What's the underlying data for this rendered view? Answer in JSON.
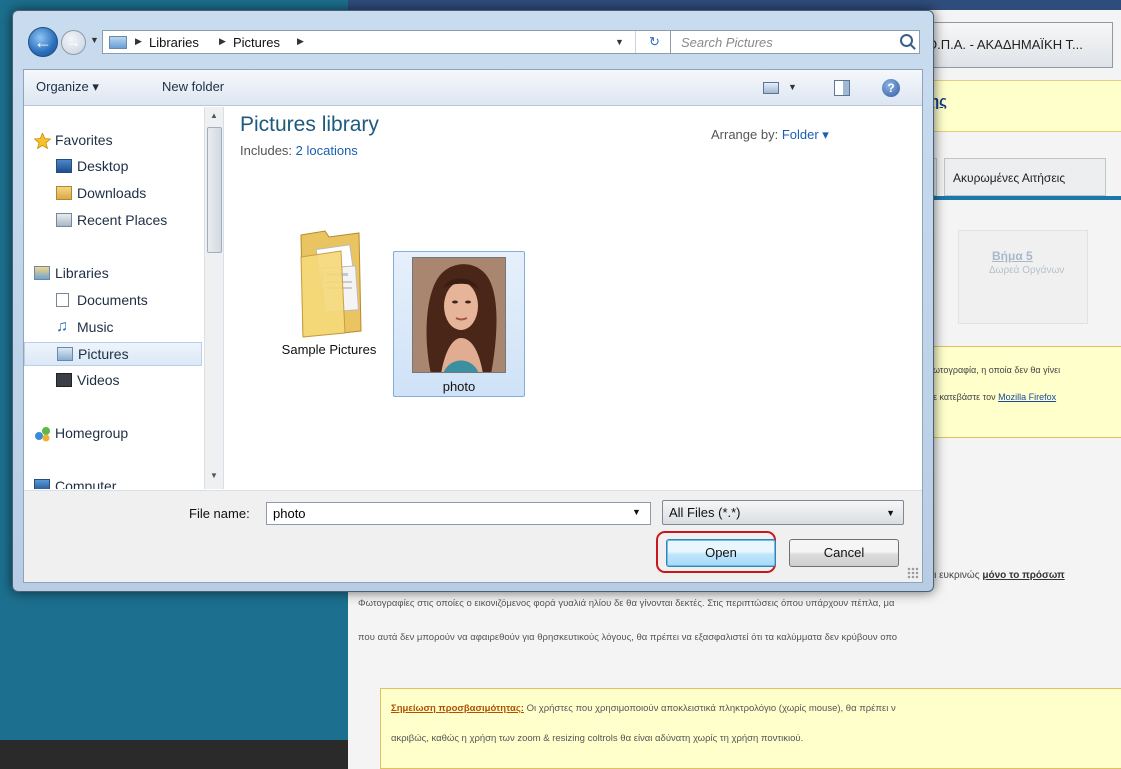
{
  "background_page": {
    "tab_title": "Ο.Π.Α. - ΑΚΑΔΗΜΑΪΚΗ Τ...",
    "header_link": "ης",
    "tabs": [
      "ς",
      "Ακυρωμένες Αιτήσεις"
    ],
    "step_title": "Βήμα 5",
    "step_subtitle": "Δωρεά Οργάνων",
    "notice_line1": "ωτογραφία, η οποία δεν θα γίνει",
    "notice_line2_prefix": "ε κατεβάστε τον ",
    "notice_link": "Mozilla Firefox",
    "partial_text_prefix": "ίζει ευκρινώς ",
    "partial_text_bold": "μόνο το πρόσωπ",
    "paragraph_line1": "Φωτογραφίες στις οποίες ο εικονιζόμενος φορά γυαλιά ηλίου δε θα γίνονται δεκτές. Στις περιπτώσεις όπου υπάρχουν πέπλα, μα",
    "paragraph_line2": "που αυτά δεν μπορούν να αφαιρεθούν για θρησκευτικούς λόγους, θα πρέπει να εξασφαλιστεί ότι τα καλύμματα δεν κρύβουν οπο",
    "accessibility_label": "Σημείωση προσβασιμότητας:",
    "accessibility_line1": " Οι χρήστες που χρησιμοποιούν αποκλειστικά πληκτρολόγιο (χωρίς mouse), θα πρέπει ν",
    "accessibility_line2": "ακριβώς, καθώς η χρήση των zoom & resizing coltrols θα είναι αδύνατη χωρίς τη χρήση ποντικιού."
  },
  "dialog": {
    "breadcrumbs": [
      "Libraries",
      "Pictures"
    ],
    "search_placeholder": "Search Pictures",
    "toolbar": {
      "organize": "Organize ▾",
      "new_folder": "New folder"
    },
    "nav": {
      "favorites": "Favorites",
      "desktop": "Desktop",
      "downloads": "Downloads",
      "recent_places": "Recent Places",
      "libraries": "Libraries",
      "documents": "Documents",
      "music": "Music",
      "pictures": "Pictures",
      "videos": "Videos",
      "homegroup": "Homegroup",
      "computer": "Computer"
    },
    "content": {
      "title": "Pictures library",
      "includes_label": "Includes: ",
      "includes_link": "2 locations",
      "arrange_label": "Arrange by: ",
      "arrange_value": "Folder ▾",
      "items": [
        {
          "name": "Sample Pictures",
          "type": "folder",
          "selected": false
        },
        {
          "name": "photo",
          "type": "image",
          "selected": true
        }
      ]
    },
    "file_name_label": "File name:",
    "file_name_value": "photo",
    "file_type_filter": "All Files (*.*)",
    "open_label": "Open",
    "cancel_label": "Cancel"
  },
  "colors": {
    "highlight_ring": "#c8181e",
    "title_blue": "#1e5a7d",
    "link_blue": "#1a5fb0"
  }
}
